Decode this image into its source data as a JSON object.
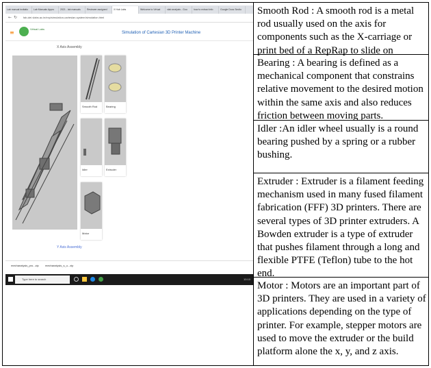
{
  "screenshot": {
    "tabs": [
      "Lab manual invitatio",
      "Lab Manuals Appro",
      "2021 - lab manuals",
      "Reviewer assigned",
      "X Hub Labs",
      "Welcome to Virtual",
      "vlab analysis - Goo",
      "how to extract info",
      "Google Docs Sectio"
    ],
    "url": "fab-dei.vlabs.ac.in/exp/simulation-cartesian-system/simulation.html",
    "logo_text": "Virtual Labs",
    "site_title": "Simulation of Cartesian 3D Printer Machine",
    "top_caption": "X Axis Assembly",
    "bottom_caption": "Y Axis Assembly",
    "parts": [
      {
        "label": "Smooth Rod"
      },
      {
        "label": "Bearing"
      },
      {
        "label": "Idler"
      },
      {
        "label": "Extruder"
      },
      {
        "label": "Motor"
      }
    ],
    "downloads": [
      "mechanalysis_pro...zip",
      "mechanalysis_s_u...zip"
    ],
    "search_placeholder": "Type here to search",
    "clock": "10:10"
  },
  "definitions": [
    {
      "text": "Smooth Rod : A smooth rod is a metal rod usually used on the axis for components such as the X-carriage or print bed of a RepRap to slide on"
    },
    {
      "text": "Bearing : A bearing is defined as a mechanical component that constrains relative movement to the desired motion within the same axis and also reduces friction between moving parts."
    },
    {
      "text": "Idler :An idler wheel usually is a round bearing pushed by a spring or a rubber bushing."
    },
    {
      "text": "Extruder : Extruder is a filament feeding mechanism used in many fused filament fabrication (FFF) 3D printers. There are several types of 3D printer extruders. A Bowden extruder is a type of extruder that pushes filament through a long and flexible PTFE (Teflon) tube to the hot end."
    },
    {
      "text": "Motor : Motors are an important part of 3D printers. They are used in a variety of applications depending on the type of printer. For example, stepper motors are used to move the extruder or the build platform alone the x, y, and z axis."
    }
  ]
}
